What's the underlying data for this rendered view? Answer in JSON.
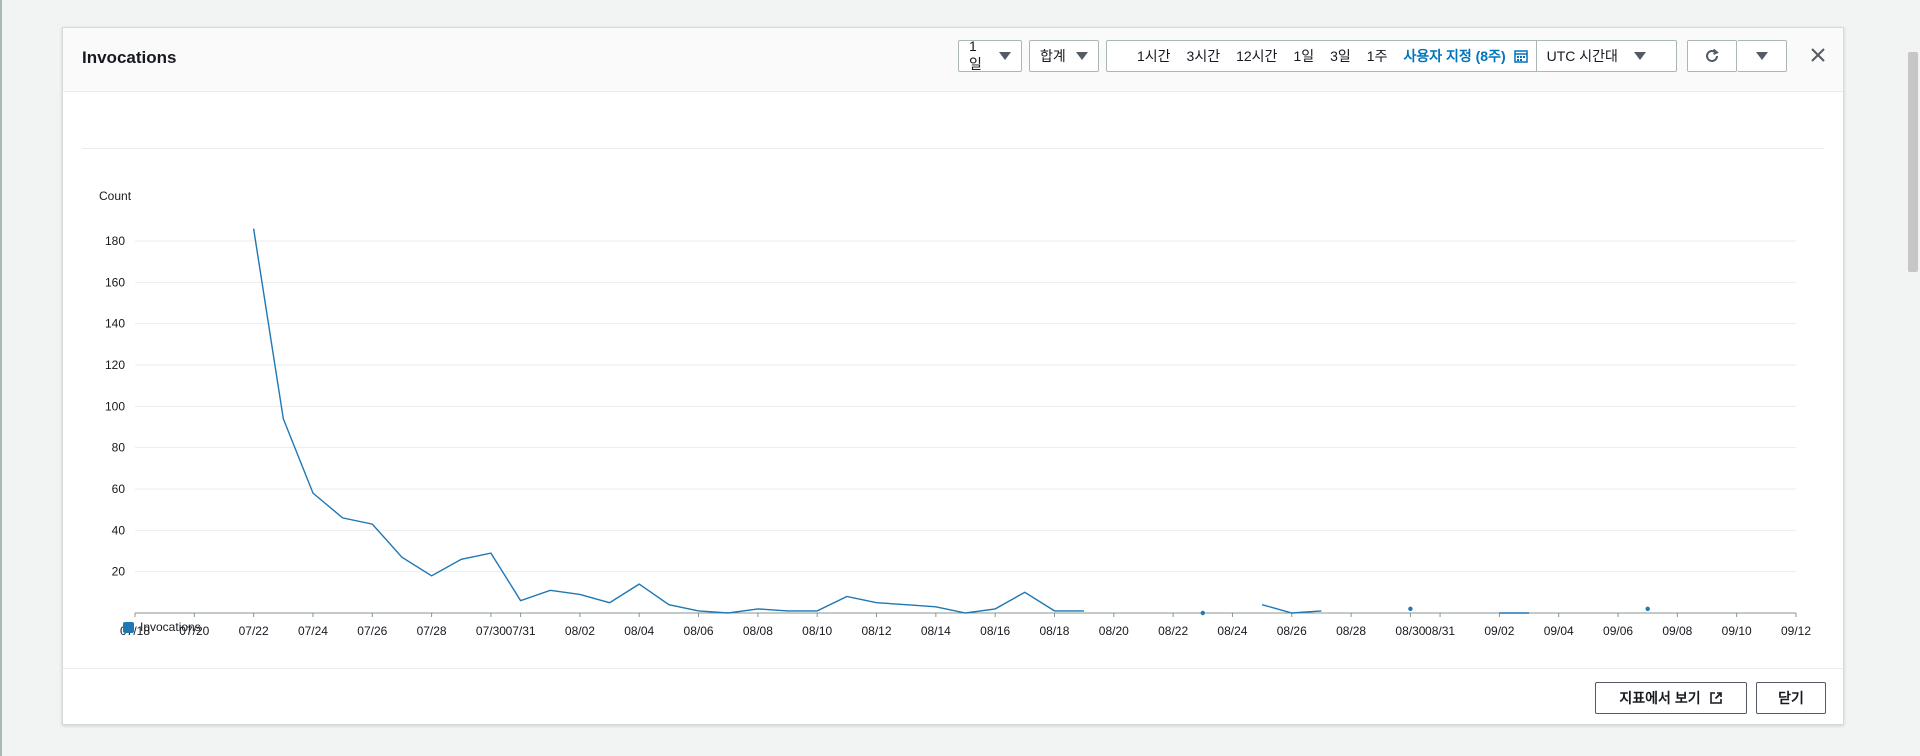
{
  "modal": {
    "title": "Invocations",
    "period": {
      "value": "1일"
    },
    "statistic": {
      "value": "합계"
    },
    "time_ranges": [
      "1시간",
      "3시간",
      "12시간",
      "1일",
      "3일",
      "1주"
    ],
    "custom_range_label": "사용자 지정 (8주)",
    "timezone": {
      "value": "UTC 시간대"
    },
    "icons": {
      "refresh": "refresh-icon",
      "dropdown": "caret-down-icon",
      "close": "close-icon",
      "calendar": "calendar-icon",
      "external": "external-link-icon"
    },
    "footer": {
      "view_in_metrics": "지표에서 보기",
      "close": "닫기"
    }
  },
  "colors": {
    "series": "#1f77b4",
    "accent": "#0073bb"
  },
  "chart_data": {
    "type": "line",
    "title": "",
    "ylabel": "Count",
    "xlabel": "",
    "ylim": [
      0,
      180
    ],
    "y_ticks": [
      20,
      40,
      60,
      80,
      100,
      120,
      140,
      160,
      180
    ],
    "grid": true,
    "legend": "bottom-left",
    "x_ticks": [
      "07/18",
      "07/20",
      "07/22",
      "07/24",
      "07/26",
      "07/28",
      "07/30",
      "07/31",
      "08/02",
      "08/04",
      "08/06",
      "08/08",
      "08/10",
      "08/12",
      "08/14",
      "08/16",
      "08/18",
      "08/20",
      "08/22",
      "08/24",
      "08/26",
      "08/28",
      "08/30",
      "08/31",
      "09/02",
      "09/04",
      "09/06",
      "09/08",
      "09/10",
      "09/12"
    ],
    "series": [
      {
        "name": "Invocations",
        "points": [
          [
            "07/22",
            186
          ],
          [
            "07/23",
            94
          ],
          [
            "07/24",
            58
          ],
          [
            "07/25",
            46
          ],
          [
            "07/26",
            43
          ],
          [
            "07/27",
            27
          ],
          [
            "07/28",
            18
          ],
          [
            "07/29",
            26
          ],
          [
            "07/30",
            29
          ],
          [
            "07/31",
            6
          ],
          [
            "08/01",
            11
          ],
          [
            "08/02",
            9
          ],
          [
            "08/03",
            5
          ],
          [
            "08/04",
            14
          ],
          [
            "08/05",
            4
          ],
          [
            "08/06",
            1
          ],
          [
            "08/07",
            0
          ],
          [
            "08/08",
            2
          ],
          [
            "08/09",
            1
          ],
          [
            "08/10",
            1
          ],
          [
            "08/11",
            8
          ],
          [
            "08/12",
            5
          ],
          [
            "08/13",
            4
          ],
          [
            "08/14",
            3
          ],
          [
            "08/15",
            0
          ],
          [
            "08/16",
            2
          ],
          [
            "08/17",
            10
          ],
          [
            "08/18",
            1
          ],
          [
            "08/19",
            1
          ],
          [
            "08/23",
            0
          ],
          [
            "08/25",
            4
          ],
          [
            "08/26",
            0
          ],
          [
            "08/27",
            1
          ],
          [
            "08/30",
            2
          ],
          [
            "09/02",
            0
          ],
          [
            "09/03",
            0
          ],
          [
            "09/07",
            2
          ]
        ]
      }
    ]
  }
}
